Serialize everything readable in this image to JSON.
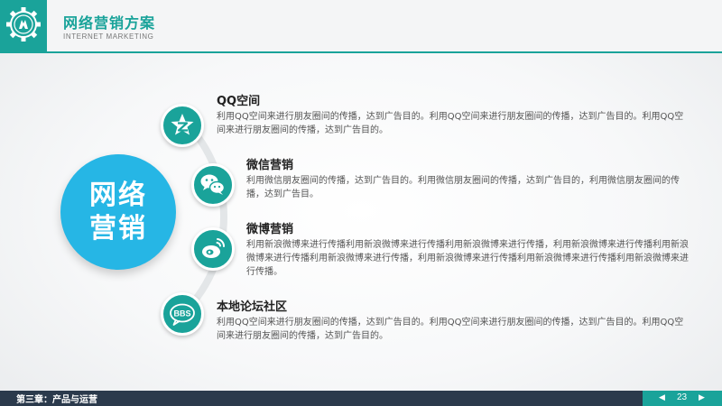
{
  "header": {
    "title": "网络营销方案",
    "subtitle": "INTERNET MARKETING",
    "accent_color": "#1aa39a",
    "logo_icon": "gear-emblem-icon"
  },
  "center": {
    "line1": "网络",
    "line2": "营销",
    "color": "#26b6e5"
  },
  "items": [
    {
      "title": "QQ空间",
      "icon": "qzone-star-icon",
      "desc": "利用QQ空间来进行朋友圈间的传播，达到广告目的。利用QQ空间来进行朋友圈间的传播，达到广告目的。利用QQ空间来进行朋友圈间的传播，达到广告目的。"
    },
    {
      "title": "微信营销",
      "icon": "wechat-icon",
      "desc": "利用微信朋友圈间的传播，达到广告目的。利用微信朋友圈间的传播，达到广告目的，利用微信朋友圈间的传播，达到广告目。"
    },
    {
      "title": "微博营销",
      "icon": "weibo-icon",
      "desc": "利用新浪微博来进行传播利用新浪微博来进行传播利用新浪微博来进行传播，利用新浪微博来进行传播利用新浪微博来进行传播利用新浪微博来进行传播，利用新浪微博来进行传播利用新浪微博来进行传播利用新浪微博来进行传播。"
    },
    {
      "title": "本地论坛社区",
      "icon": "bbs-bubble-icon",
      "icon_text": "BBS",
      "desc": "利用QQ空间来进行朋友圈间的传播，达到广告目的。利用QQ空间来进行朋友圈间的传播，达到广告目的。利用QQ空间来进行朋友圈间的传播，达到广告目的。"
    }
  ],
  "footer": {
    "chapter": "第三章：产品与运营",
    "page": "23",
    "prev_icon": "triangle-left-icon",
    "next_icon": "triangle-right-icon"
  }
}
